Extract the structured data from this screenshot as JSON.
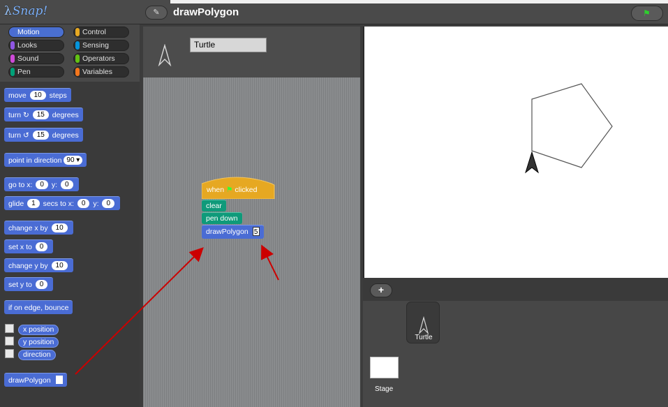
{
  "app": {
    "logo": "Snap!",
    "project_title": "drawPolygon"
  },
  "categories": [
    {
      "label": "Motion",
      "color": "#4a6cd4",
      "active": true
    },
    {
      "label": "Control",
      "color": "#e6a822"
    },
    {
      "label": "Looks",
      "color": "#8f56e3"
    },
    {
      "label": "Sensing",
      "color": "#0494dc"
    },
    {
      "label": "Sound",
      "color": "#cf4ad9"
    },
    {
      "label": "Operators",
      "color": "#62c213"
    },
    {
      "label": "Pen",
      "color": "#00a178"
    },
    {
      "label": "Variables",
      "color": "#f3761d"
    }
  ],
  "palette": {
    "move": {
      "pre": "move",
      "val": "10",
      "post": "steps"
    },
    "turn_cw": {
      "pre": "turn",
      "icon": "↻",
      "val": "15",
      "post": "degrees"
    },
    "turn_ccw": {
      "pre": "turn",
      "icon": "↺",
      "val": "15",
      "post": "degrees"
    },
    "point_dir": {
      "pre": "point in direction",
      "val": "90"
    },
    "goto": {
      "pre": "go to x:",
      "x": "0",
      "mid": "y:",
      "y": "0"
    },
    "glide": {
      "pre": "glide",
      "secs": "1",
      "mid1": "secs to x:",
      "x": "0",
      "mid2": "y:",
      "y": "0"
    },
    "change_x": {
      "pre": "change x by",
      "val": "10"
    },
    "set_x": {
      "pre": "set x to",
      "val": "0"
    },
    "change_y": {
      "pre": "change y by",
      "val": "10"
    },
    "set_y": {
      "pre": "set y to",
      "val": "0"
    },
    "bounce": "if on edge, bounce",
    "reporters": [
      "x position",
      "y position",
      "direction"
    ],
    "custom": "drawPolygon"
  },
  "sprite": {
    "name": "Turtle"
  },
  "script": {
    "hat_pre": "when",
    "hat_post": "clicked",
    "clear": "clear",
    "pen_down": "pen down",
    "draw": "drawPolygon",
    "draw_arg": "5"
  },
  "corral": {
    "sprite_label": "Turtle",
    "stage_label": "Stage",
    "add_label": "+"
  }
}
